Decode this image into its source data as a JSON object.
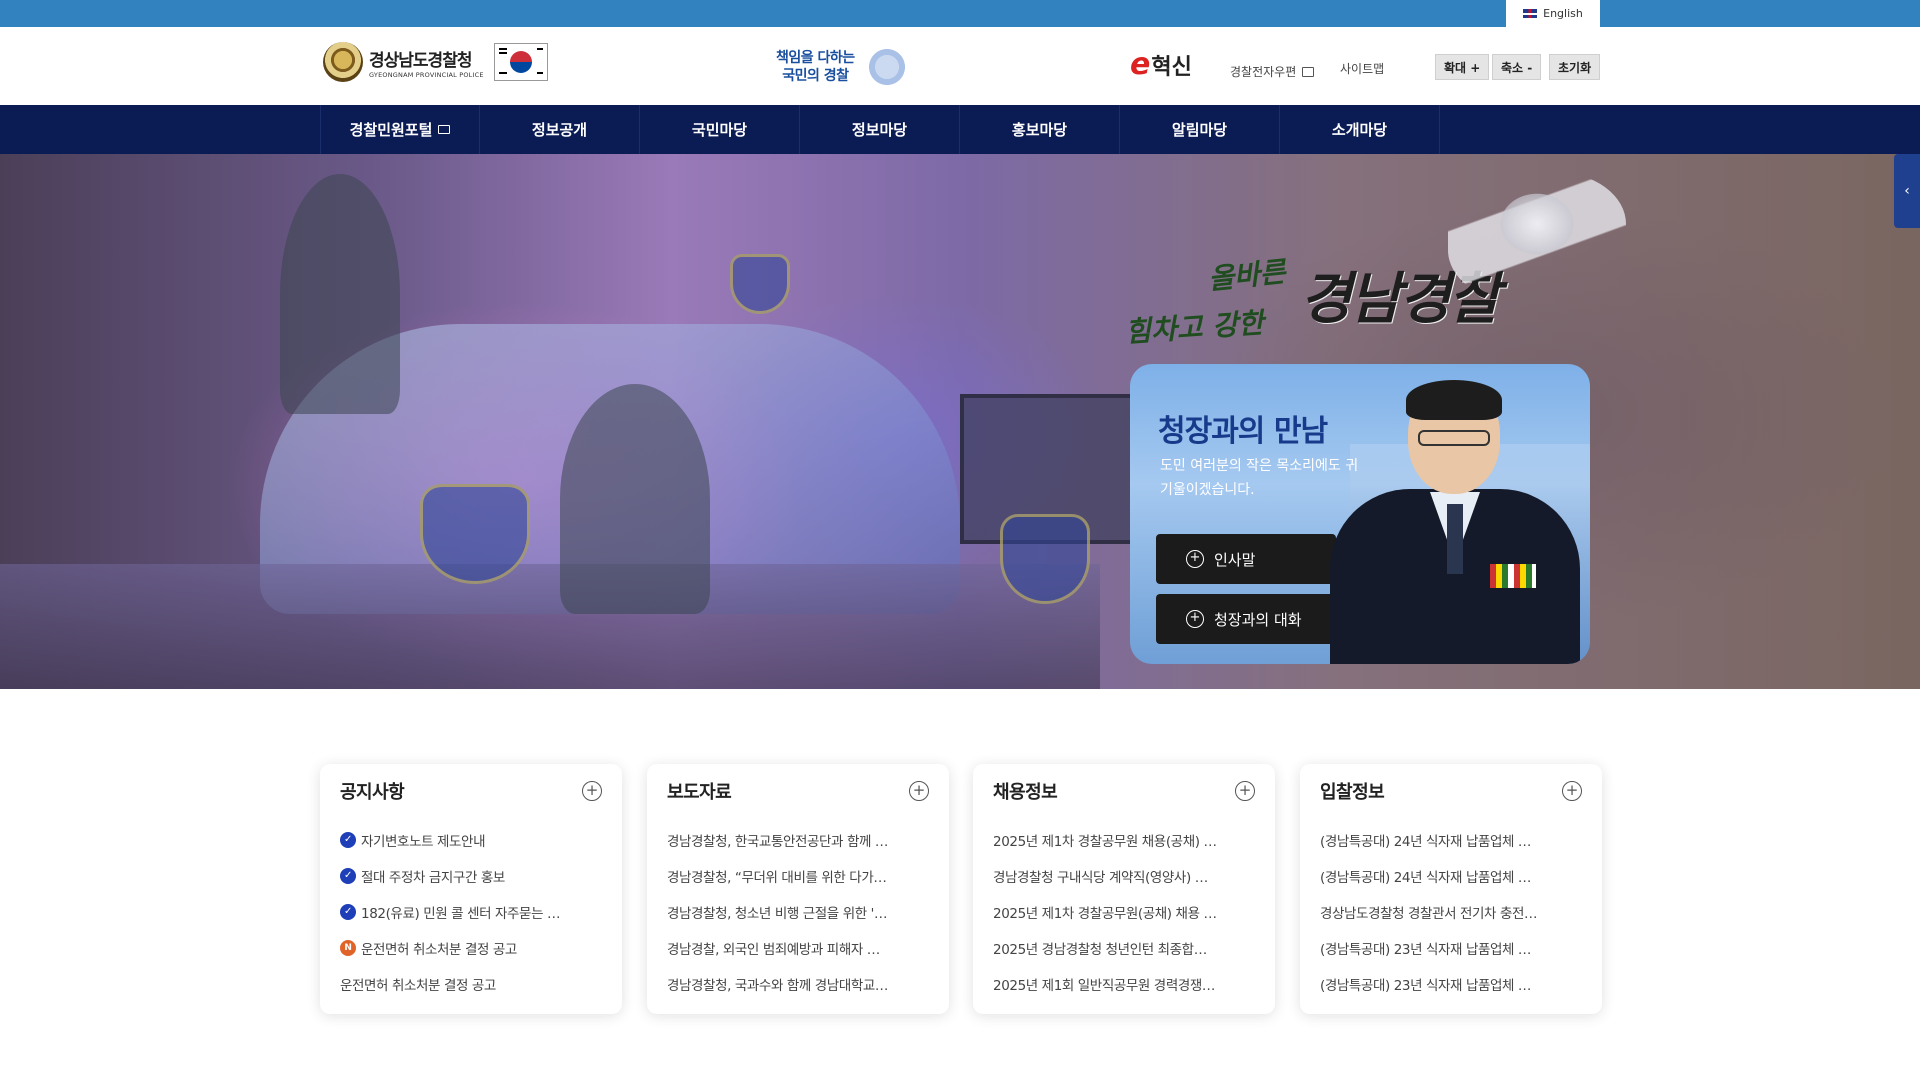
{
  "top_bar": {
    "language_label": "English"
  },
  "header": {
    "logo_korean": "경상남도경찰청",
    "logo_english": "GYEONGNAM PROVINCIAL POLICE",
    "slogan_line1": "책임을 다하는",
    "slogan_line2": "국민의 경찰",
    "ehyeoksin_e": "e",
    "ehyeoksin_text": "혁신",
    "util_links": [
      "경찰전자우편",
      "사이트맵"
    ],
    "zoom_in": "확대 +",
    "zoom_out": "축소 -",
    "reset": "초기화"
  },
  "nav": {
    "items": [
      "경찰민원포털",
      "정보공개",
      "국민마당",
      "정보마당",
      "홍보마당",
      "알림마당",
      "소개마당"
    ]
  },
  "hero": {
    "slogan_small1": "올바른",
    "slogan_small2": "힘차고 강한",
    "slogan_big": "경남경찰"
  },
  "commissioner_card": {
    "title": "청장과의 만남",
    "description": "도민 여러분의 작은 목소리에도 귀기울이겠습니다.",
    "buttons": [
      "인사말",
      "청장과의 대화"
    ]
  },
  "boards": [
    {
      "title": "공지사항",
      "items": [
        {
          "text": "자기변호노트 제도안내",
          "badge": "check"
        },
        {
          "text": "절대 주정차 금지구간 홍보",
          "badge": "check"
        },
        {
          "text": "182(유료) 민원 콜 센터 자주묻는 …",
          "badge": "check"
        },
        {
          "text": "운전면허 취소처분 결정 공고",
          "badge": "new"
        },
        {
          "text": "운전면허 취소처분 결정 공고",
          "badge": ""
        }
      ]
    },
    {
      "title": "보도자료",
      "items": [
        {
          "text": "경남경찰청, 한국교통안전공단과 함께 …",
          "badge": ""
        },
        {
          "text": "경남경찰청, “무더위 대비를 위한 다가…",
          "badge": ""
        },
        {
          "text": "경남경찰청, 청소년 비행 근절을 위한 '…",
          "badge": ""
        },
        {
          "text": "경남경찰, 외국인 범죄예방과 피해자 …",
          "badge": ""
        },
        {
          "text": "경남경찰청, 국과수와 함께 경남대학교…",
          "badge": ""
        }
      ]
    },
    {
      "title": "채용정보",
      "items": [
        {
          "text": "2025년 제1차 경찰공무원 채용(공채) …",
          "badge": ""
        },
        {
          "text": "경남경찰청 구내식당 계약직(영양사) …",
          "badge": ""
        },
        {
          "text": "2025년 제1차 경찰공무원(공채) 채용 …",
          "badge": ""
        },
        {
          "text": "2025년 경남경찰청 청년인턴 최종합…",
          "badge": ""
        },
        {
          "text": "2025년 제1회 일반직공무원 경력경쟁…",
          "badge": ""
        }
      ]
    },
    {
      "title": "입찰정보",
      "items": [
        {
          "text": "(경남특공대) 24년 식자재 납품업체 …",
          "badge": ""
        },
        {
          "text": "(경남특공대) 24년 식자재 납품업체 …",
          "badge": ""
        },
        {
          "text": "경상남도경찰청 경찰관서 전기차 충전…",
          "badge": ""
        },
        {
          "text": "(경남특공대) 23년 식자재 납품업체 …",
          "badge": ""
        },
        {
          "text": "(경남특공대) 23년 식자재 납품업체 …",
          "badge": ""
        }
      ]
    }
  ],
  "colors": {
    "top_bar": "#3182bf",
    "nav_bg": "#0b1b54",
    "card_title": "#173a8a",
    "check_badge": "#1e3fb8",
    "new_badge": "#e0642a"
  },
  "icons": {
    "check_badge": "check-icon",
    "new_badge": "new-icon",
    "board_more": "plus-circle-icon",
    "side_tab": "chevron-left-icon"
  }
}
